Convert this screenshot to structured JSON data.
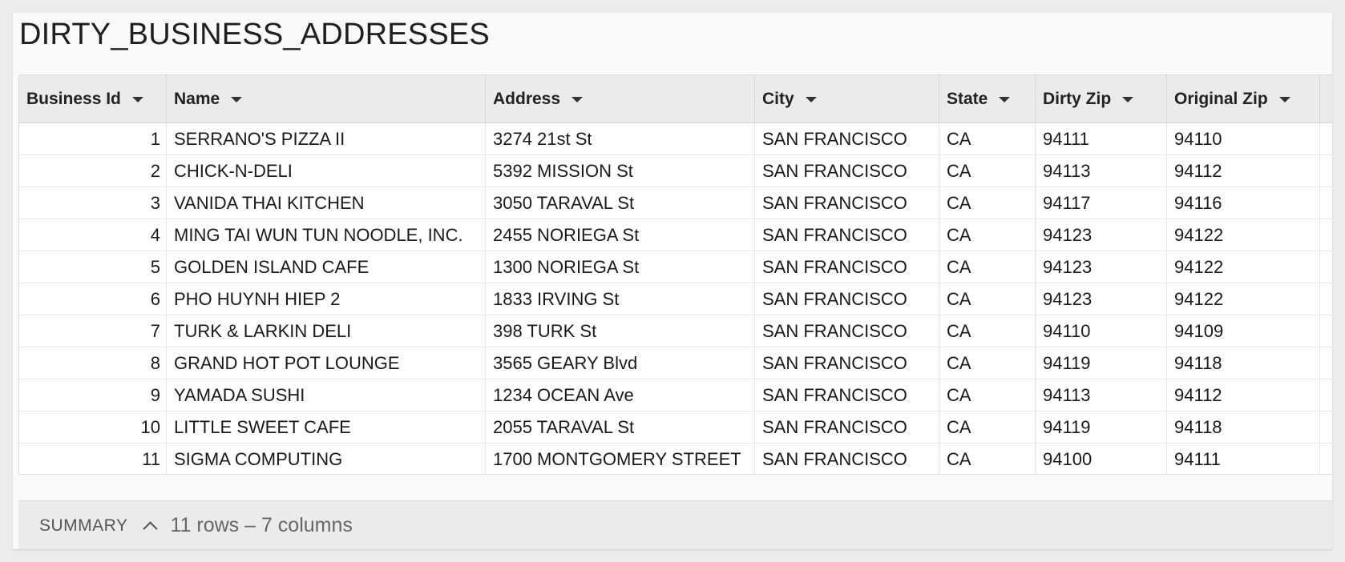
{
  "title": "DIRTY_BUSINESS_ADDRESSES",
  "columns": [
    "Business Id",
    "Name",
    "Address",
    "City",
    "State",
    "Dirty Zip",
    "Original Zip"
  ],
  "rows": [
    [
      "1",
      "SERRANO'S PIZZA II",
      "3274 21st St",
      "SAN FRANCISCO",
      "CA",
      "94111",
      "94110"
    ],
    [
      "2",
      "CHICK-N-DELI",
      "5392 MISSION St",
      "SAN FRANCISCO",
      "CA",
      "94113",
      "94112"
    ],
    [
      "3",
      "VANIDA THAI KITCHEN",
      "3050 TARAVAL St",
      "SAN FRANCISCO",
      "CA",
      "94117",
      "94116"
    ],
    [
      "4",
      "MING TAI WUN TUN NOODLE, INC.",
      "2455 NORIEGA St",
      "SAN FRANCISCO",
      "CA",
      "94123",
      "94122"
    ],
    [
      "5",
      "GOLDEN ISLAND CAFE",
      "1300 NORIEGA St",
      "SAN FRANCISCO",
      "CA",
      "94123",
      "94122"
    ],
    [
      "6",
      "PHO HUYNH HIEP 2",
      "1833 IRVING St",
      "SAN FRANCISCO",
      "CA",
      "94123",
      "94122"
    ],
    [
      "7",
      "TURK & LARKIN DELI",
      "398 TURK St",
      "SAN FRANCISCO",
      "CA",
      "94110",
      "94109"
    ],
    [
      "8",
      "GRAND HOT POT LOUNGE",
      "3565 GEARY Blvd",
      "SAN FRANCISCO",
      "CA",
      "94119",
      "94118"
    ],
    [
      "9",
      "YAMADA SUSHI",
      "1234 OCEAN Ave",
      "SAN FRANCISCO",
      "CA",
      "94113",
      "94112"
    ],
    [
      "10",
      "LITTLE SWEET CAFE",
      "2055 TARAVAL St",
      "SAN FRANCISCO",
      "CA",
      "94119",
      "94118"
    ],
    [
      "11",
      "SIGMA COMPUTING",
      "1700 MONTGOMERY STREET",
      "SAN FRANCISCO",
      "CA",
      "94100",
      "94111"
    ]
  ],
  "summary": {
    "label": "SUMMARY",
    "info": "11 rows – 7 columns"
  },
  "icons": {
    "column_menu": "caret-down-icon",
    "summary_toggle": "chevron-up-icon"
  }
}
